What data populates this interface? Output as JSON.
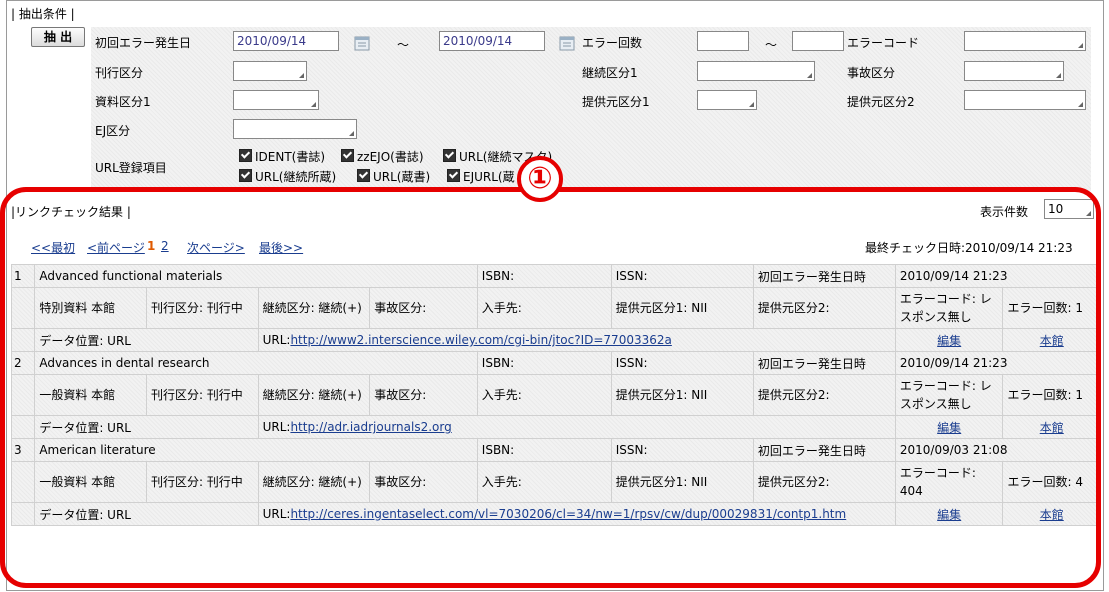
{
  "filters": {
    "section_title": "| 抽出条件 |",
    "extract_button": "抽 出",
    "first_error_label": "初回エラー発生日",
    "date_from": "2010/09/14",
    "date_to": "2010/09/14",
    "range_sep": "～",
    "error_count_label": "エラー回数",
    "error_count_from": "",
    "error_count_to": "",
    "error_code_label": "エラーコード",
    "kankou_label": "刊行区分",
    "keizoku_label": "継続区分1",
    "jiko_label": "事故区分",
    "shiryo_label": "資料区分1",
    "teikyo1_label": "提供元区分1",
    "teikyo2_label": "提供元区分2",
    "ej_label": "EJ区分",
    "url_items_label": "URL登録項目",
    "url_items": [
      "IDENT(書誌)",
      "zzEJO(書誌)",
      "URL(継続マスタ)",
      "URL(継続所蔵)",
      "URL(蔵書)",
      "EJURL(蔵"
    ]
  },
  "results": {
    "section_title": "|リンクチェック結果 |",
    "display_count_label": "表示件数",
    "display_count_value": "10",
    "last_check": "最終チェック日時:2010/09/14 21:23",
    "pager": {
      "first": "<<最初",
      "prev": "<前ページ",
      "pages": [
        "1",
        "2"
      ],
      "next": "次ページ>",
      "last": "最後>>"
    },
    "rows": [
      {
        "idx": "1",
        "title": "Advanced functional materials",
        "isbn": "ISBN:",
        "issn": "ISSN:",
        "first_error_label": "初回エラー発生日時",
        "first_error": "2010/09/14 21:23",
        "shiryo": "特別資料 本館",
        "kankou": "刊行区分: 刊行中",
        "keizoku": "継続区分: 継続(+)",
        "jiko": "事故区分:",
        "nyushu": "入手先:",
        "teikyo1": "提供元区分1: NII",
        "teikyo2": "提供元区分2:",
        "error_code": "エラーコード: レスポンス無し",
        "error_count": "エラー回数: 1",
        "data_pos": "データ位置: URL",
        "url_label": "URL:",
        "url": "http://www2.interscience.wiley.com/cgi-bin/jtoc?ID=77003362a",
        "edit": "編集",
        "honkan": "本館"
      },
      {
        "idx": "2",
        "title": "Advances in dental research",
        "isbn": "ISBN:",
        "issn": "ISSN:",
        "first_error_label": "初回エラー発生日時",
        "first_error": "2010/09/14 21:23",
        "shiryo": "一般資料 本館",
        "kankou": "刊行区分: 刊行中",
        "keizoku": "継続区分: 継続(+)",
        "jiko": "事故区分:",
        "nyushu": "入手先:",
        "teikyo1": "提供元区分1: NII",
        "teikyo2": "提供元区分2:",
        "error_code": "エラーコード: レスポンス無し",
        "error_count": "エラー回数: 1",
        "data_pos": "データ位置: URL",
        "url_label": "URL:",
        "url": "http://adr.iadrjournals2.org",
        "edit": "編集",
        "honkan": "本館"
      },
      {
        "idx": "3",
        "title": "American literature",
        "isbn": "ISBN:",
        "issn": "ISSN:",
        "first_error_label": "初回エラー発生日時",
        "first_error": "2010/09/03 21:08",
        "shiryo": "一般資料 本館",
        "kankou": "刊行区分: 刊行中",
        "keizoku": "継続区分: 継続(+)",
        "jiko": "事故区分:",
        "nyushu": "入手先:",
        "teikyo1": "提供元区分1: NII",
        "teikyo2": "提供元区分2:",
        "error_code": "エラーコード: 404",
        "error_count": "エラー回数: 4",
        "data_pos": "データ位置: URL",
        "url_label": "URL:",
        "url": "http://ceres.ingentaselect.com/vl=7030206/cl=34/nw=1/rpsv/cw/dup/00029831/contp1.htm",
        "edit": "編集",
        "honkan": "本館"
      }
    ]
  },
  "annotation": {
    "marker": "①",
    "color": "#e60000"
  }
}
